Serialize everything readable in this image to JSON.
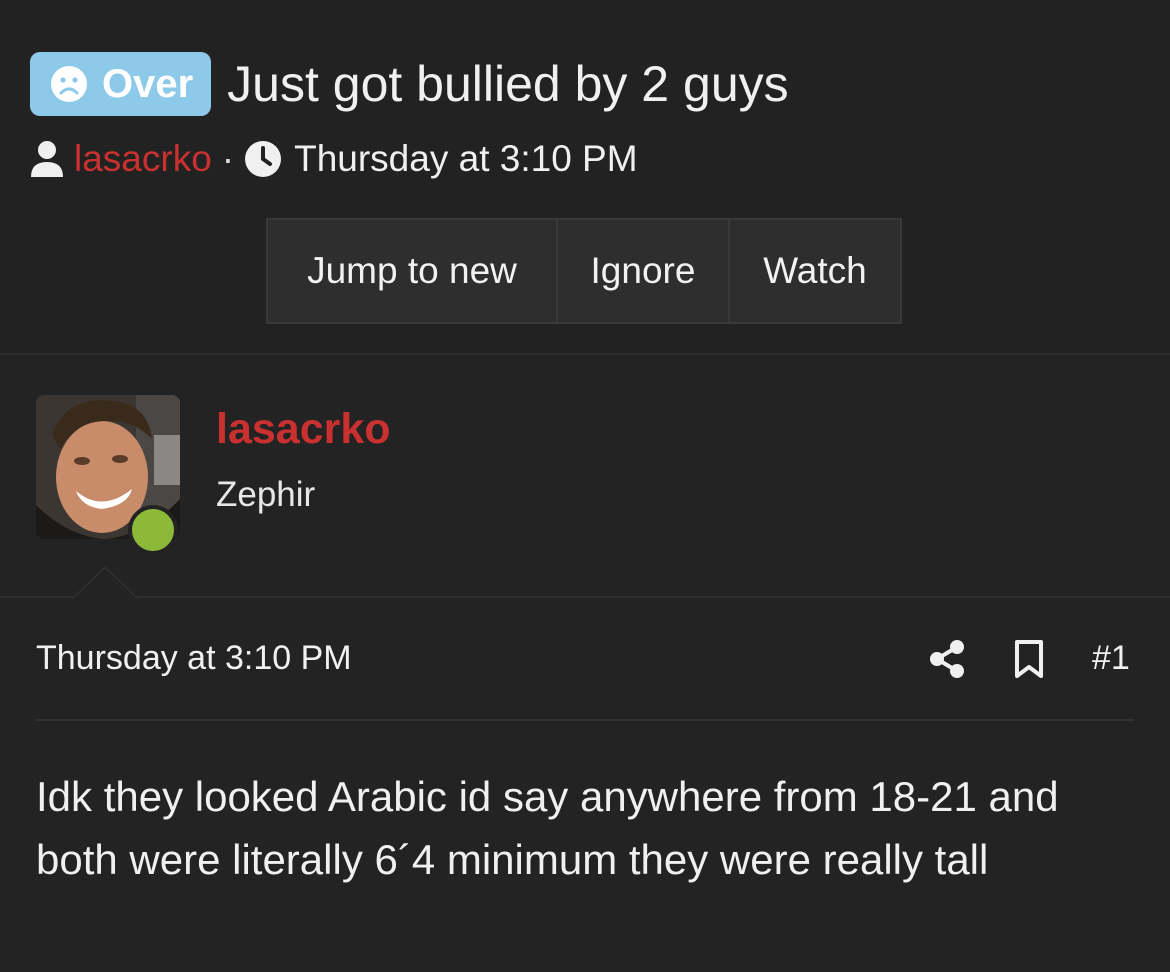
{
  "thread": {
    "prefix_label": "Over",
    "prefix_icon": "sad-face-icon",
    "prefix_color": "#8dcaea",
    "title": "Just got bullied by 2 guys",
    "author": "lasacrko",
    "separator": "·",
    "date": "Thursday at 3:10 PM"
  },
  "actions": {
    "jump_label": "Jump to new",
    "ignore_label": "Ignore",
    "watch_label": "Watch"
  },
  "post": {
    "username": "lasacrko",
    "user_title": "Zephir",
    "online_status_color": "#8cba38",
    "date": "Thursday at 3:10 PM",
    "post_number": "#1",
    "body": "Idk they looked Arabic id say anywhere from 18-21 and both were literally 6´4 minimum they were really tall"
  },
  "colors": {
    "accent_username": "#c8312f",
    "background": "#232323"
  }
}
